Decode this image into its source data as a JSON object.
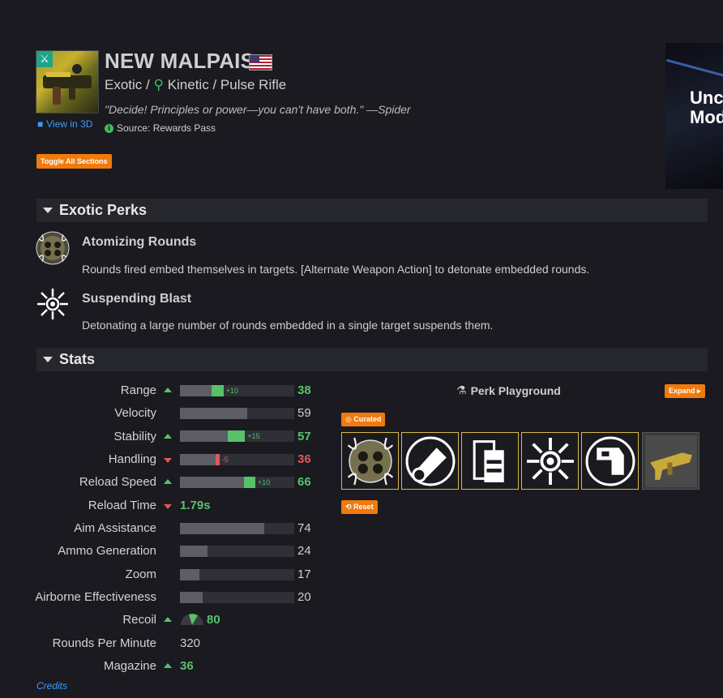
{
  "weapon": {
    "name": "NEW MALPAIS",
    "rarity": "Exotic",
    "damage_type": "Kinetic",
    "weapon_type": "Pulse Rifle",
    "flavor_text": "\"Decide! Principles or power—you can't have both.\" —Spider",
    "source": "Source: Rewards Pass",
    "view_3d": "View in 3D",
    "separator": "/"
  },
  "toolbar": {
    "toggle_all": "Toggle All Sections"
  },
  "ad": {
    "text_line1": "Unc",
    "text_line2": "Mod"
  },
  "sections": {
    "exotic_perks": "Exotic Perks",
    "stats": "Stats"
  },
  "perks": [
    {
      "name": "Atomizing Rounds",
      "description": "Rounds fired embed themselves in targets. [Alternate Weapon Action] to detonate embedded rounds."
    },
    {
      "name": "Suspending Blast",
      "description": "Detonating a large number of rounds embedded in a single target suspends them."
    }
  ],
  "stats": {
    "range": {
      "label": "Range",
      "base": 28,
      "mod": 10,
      "mod_label": "+10",
      "value": "38",
      "trend": "up"
    },
    "velocity": {
      "label": "Velocity",
      "base": 59,
      "value": "59"
    },
    "stability": {
      "label": "Stability",
      "base": 42,
      "mod": 15,
      "mod_label": "+15",
      "value": "57",
      "trend": "up"
    },
    "handling": {
      "label": "Handling",
      "base": 36,
      "mod": -5,
      "mod_label": "-5",
      "value": "36",
      "trend": "down"
    },
    "reload": {
      "label": "Reload Speed",
      "base": 56,
      "mod": 10,
      "mod_label": "+10",
      "value": "66",
      "trend": "up"
    },
    "reload_time": {
      "label": "Reload Time",
      "value": "1.79s",
      "trend": "down"
    },
    "aim": {
      "label": "Aim Assistance",
      "base": 74,
      "value": "74"
    },
    "ammo": {
      "label": "Ammo Generation",
      "base": 24,
      "value": "24"
    },
    "zoom": {
      "label": "Zoom",
      "base": 17,
      "value": "17"
    },
    "airborne": {
      "label": "Airborne Effectiveness",
      "base": 20,
      "value": "20"
    },
    "recoil": {
      "label": "Recoil",
      "value": "80",
      "trend": "up"
    },
    "rpm": {
      "label": "Rounds Per Minute",
      "value": "320"
    },
    "magazine": {
      "label": "Magazine",
      "value": "36",
      "trend": "up"
    }
  },
  "playground": {
    "title": "Perk Playground",
    "expand": "Expand",
    "curated": "Curated",
    "reset": "Reset",
    "slots": [
      "atomizing-rounds-icon",
      "barrel-icon",
      "magazine-icon",
      "suspending-blast-icon",
      "stock-icon",
      "weapon-ornament-icon"
    ]
  },
  "footer": {
    "credits": "Credits"
  },
  "colors": {
    "accent": "#f07a0c",
    "positive": "#57c26a",
    "negative": "#e0585b",
    "link": "#3c9bff"
  }
}
